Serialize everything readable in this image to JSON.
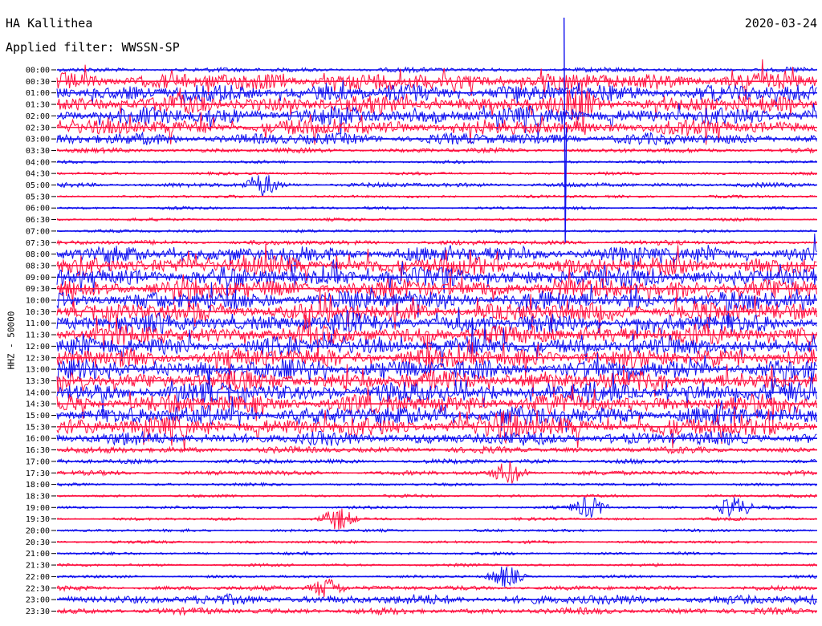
{
  "header": {
    "station": "HA Kallithea",
    "filter": "Applied filter: WWSSN-SP",
    "date": "2020-03-24"
  },
  "channel_label": "HHZ - 50000",
  "colors": {
    "trace_a": "#1010ee",
    "trace_b": "#ff1040",
    "axis": "#000000"
  },
  "chart_data": {
    "type": "line",
    "title": "HA Kallithea",
    "subtitle": "Applied filter: WWSSN-SP",
    "ylabel": "HHZ - 50000",
    "date": "2020-03-24",
    "rows": [
      "00:00",
      "00:30",
      "01:00",
      "01:30",
      "02:00",
      "02:30",
      "03:00",
      "03:30",
      "04:00",
      "04:30",
      "05:00",
      "05:30",
      "06:00",
      "06:30",
      "07:00",
      "07:30",
      "08:00",
      "08:30",
      "09:00",
      "09:30",
      "10:00",
      "10:30",
      "11:00",
      "11:30",
      "12:00",
      "12:30",
      "13:00",
      "13:30",
      "14:00",
      "14:30",
      "15:00",
      "15:30",
      "16:00",
      "16:30",
      "17:00",
      "17:30",
      "18:00",
      "18:30",
      "19:00",
      "19:30",
      "20:00",
      "20:30",
      "21:00",
      "21:30",
      "22:00",
      "22:30",
      "23:00",
      "23:30"
    ],
    "row_colors": "alternating blue/red, starting blue at 00:00",
    "activity_level": [
      2,
      9,
      9,
      9,
      9,
      8,
      6,
      2,
      1,
      1,
      2,
      1,
      1,
      1,
      1,
      2,
      8,
      10,
      10,
      10,
      10,
      10,
      10,
      10,
      10,
      10,
      10,
      10,
      10,
      10,
      10,
      10,
      7,
      3,
      2,
      2,
      1,
      1,
      1,
      1,
      1,
      1,
      1,
      1,
      1,
      2,
      5,
      3
    ],
    "notable_events": [
      {
        "row": "01:30",
        "x_fraction": 0.685,
        "amplitude": "large, spans 00:00–07:30"
      },
      {
        "row": "05:00",
        "x_fraction": 0.27,
        "amplitude": "moderate burst"
      },
      {
        "row": "15:30",
        "x_fraction": 0.59,
        "amplitude": "large burst"
      },
      {
        "row": "17:30",
        "x_fraction": 0.595,
        "amplitude": "moderate"
      },
      {
        "row": "19:00",
        "x_fraction": 0.7,
        "amplitude": "moderate"
      },
      {
        "row": "19:00",
        "x_fraction": 0.89,
        "amplitude": "moderate"
      },
      {
        "row": "19:30",
        "x_fraction": 0.37,
        "amplitude": "moderate"
      },
      {
        "row": "22:00",
        "x_fraction": 0.59,
        "amplitude": "moderate"
      },
      {
        "row": "22:30",
        "x_fraction": 0.355,
        "amplitude": "moderate"
      }
    ],
    "grid": false,
    "legend": "none"
  }
}
